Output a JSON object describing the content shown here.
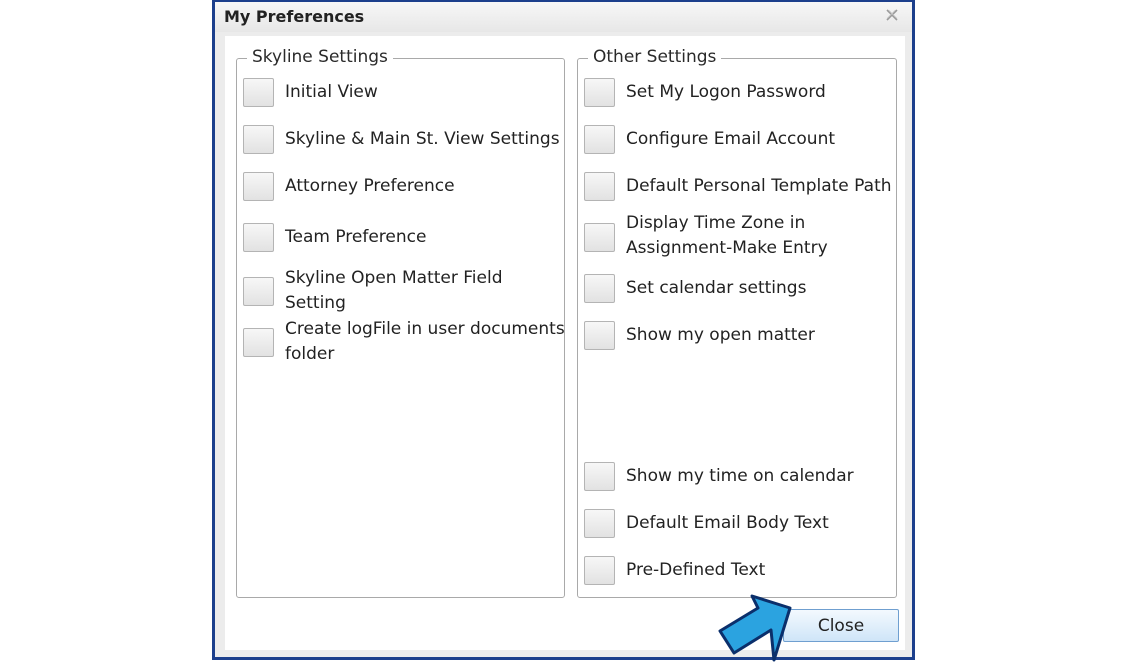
{
  "window": {
    "title": "My Preferences",
    "close_icon": "close-x-icon",
    "border_color": "#1c3f8c"
  },
  "skyline_settings": {
    "title": "Skyline Settings",
    "items": [
      {
        "label": "Initial View",
        "checked": false
      },
      {
        "label": "Skyline & Main St. View Settings",
        "checked": false
      },
      {
        "label": "Attorney Preference",
        "checked": false
      },
      {
        "label": "Team Preference",
        "checked": false
      },
      {
        "label_line1": "Skyline Open Matter Field",
        "label_line2": "Setting",
        "checked": false
      },
      {
        "label_line1": "Create logFile in user documents",
        "label_line2": "folder",
        "checked": false
      }
    ]
  },
  "other_settings": {
    "title": "Other Settings",
    "items": [
      {
        "label": "Set My Logon Password",
        "checked": false
      },
      {
        "label": "Configure Email Account",
        "checked": false
      },
      {
        "label": "Default Personal Template Path",
        "checked": false
      },
      {
        "label_line1": "Display Time Zone in",
        "label_line2": "Assignment-Make Entry",
        "checked": false
      },
      {
        "label": "Set calendar settings",
        "checked": false
      },
      {
        "label": "Show my open matter",
        "checked": false
      },
      {
        "label": "Show my time on calendar",
        "checked": false
      },
      {
        "label": "Default Email Body Text",
        "checked": false
      },
      {
        "label": "Pre-Defined Text",
        "checked": false
      }
    ]
  },
  "buttons": {
    "close_label": "Close"
  },
  "annotation": {
    "icon": "pointer-arrow-icon",
    "fill_color": "#2ba3e0",
    "stroke_color": "#0b2f6b"
  }
}
